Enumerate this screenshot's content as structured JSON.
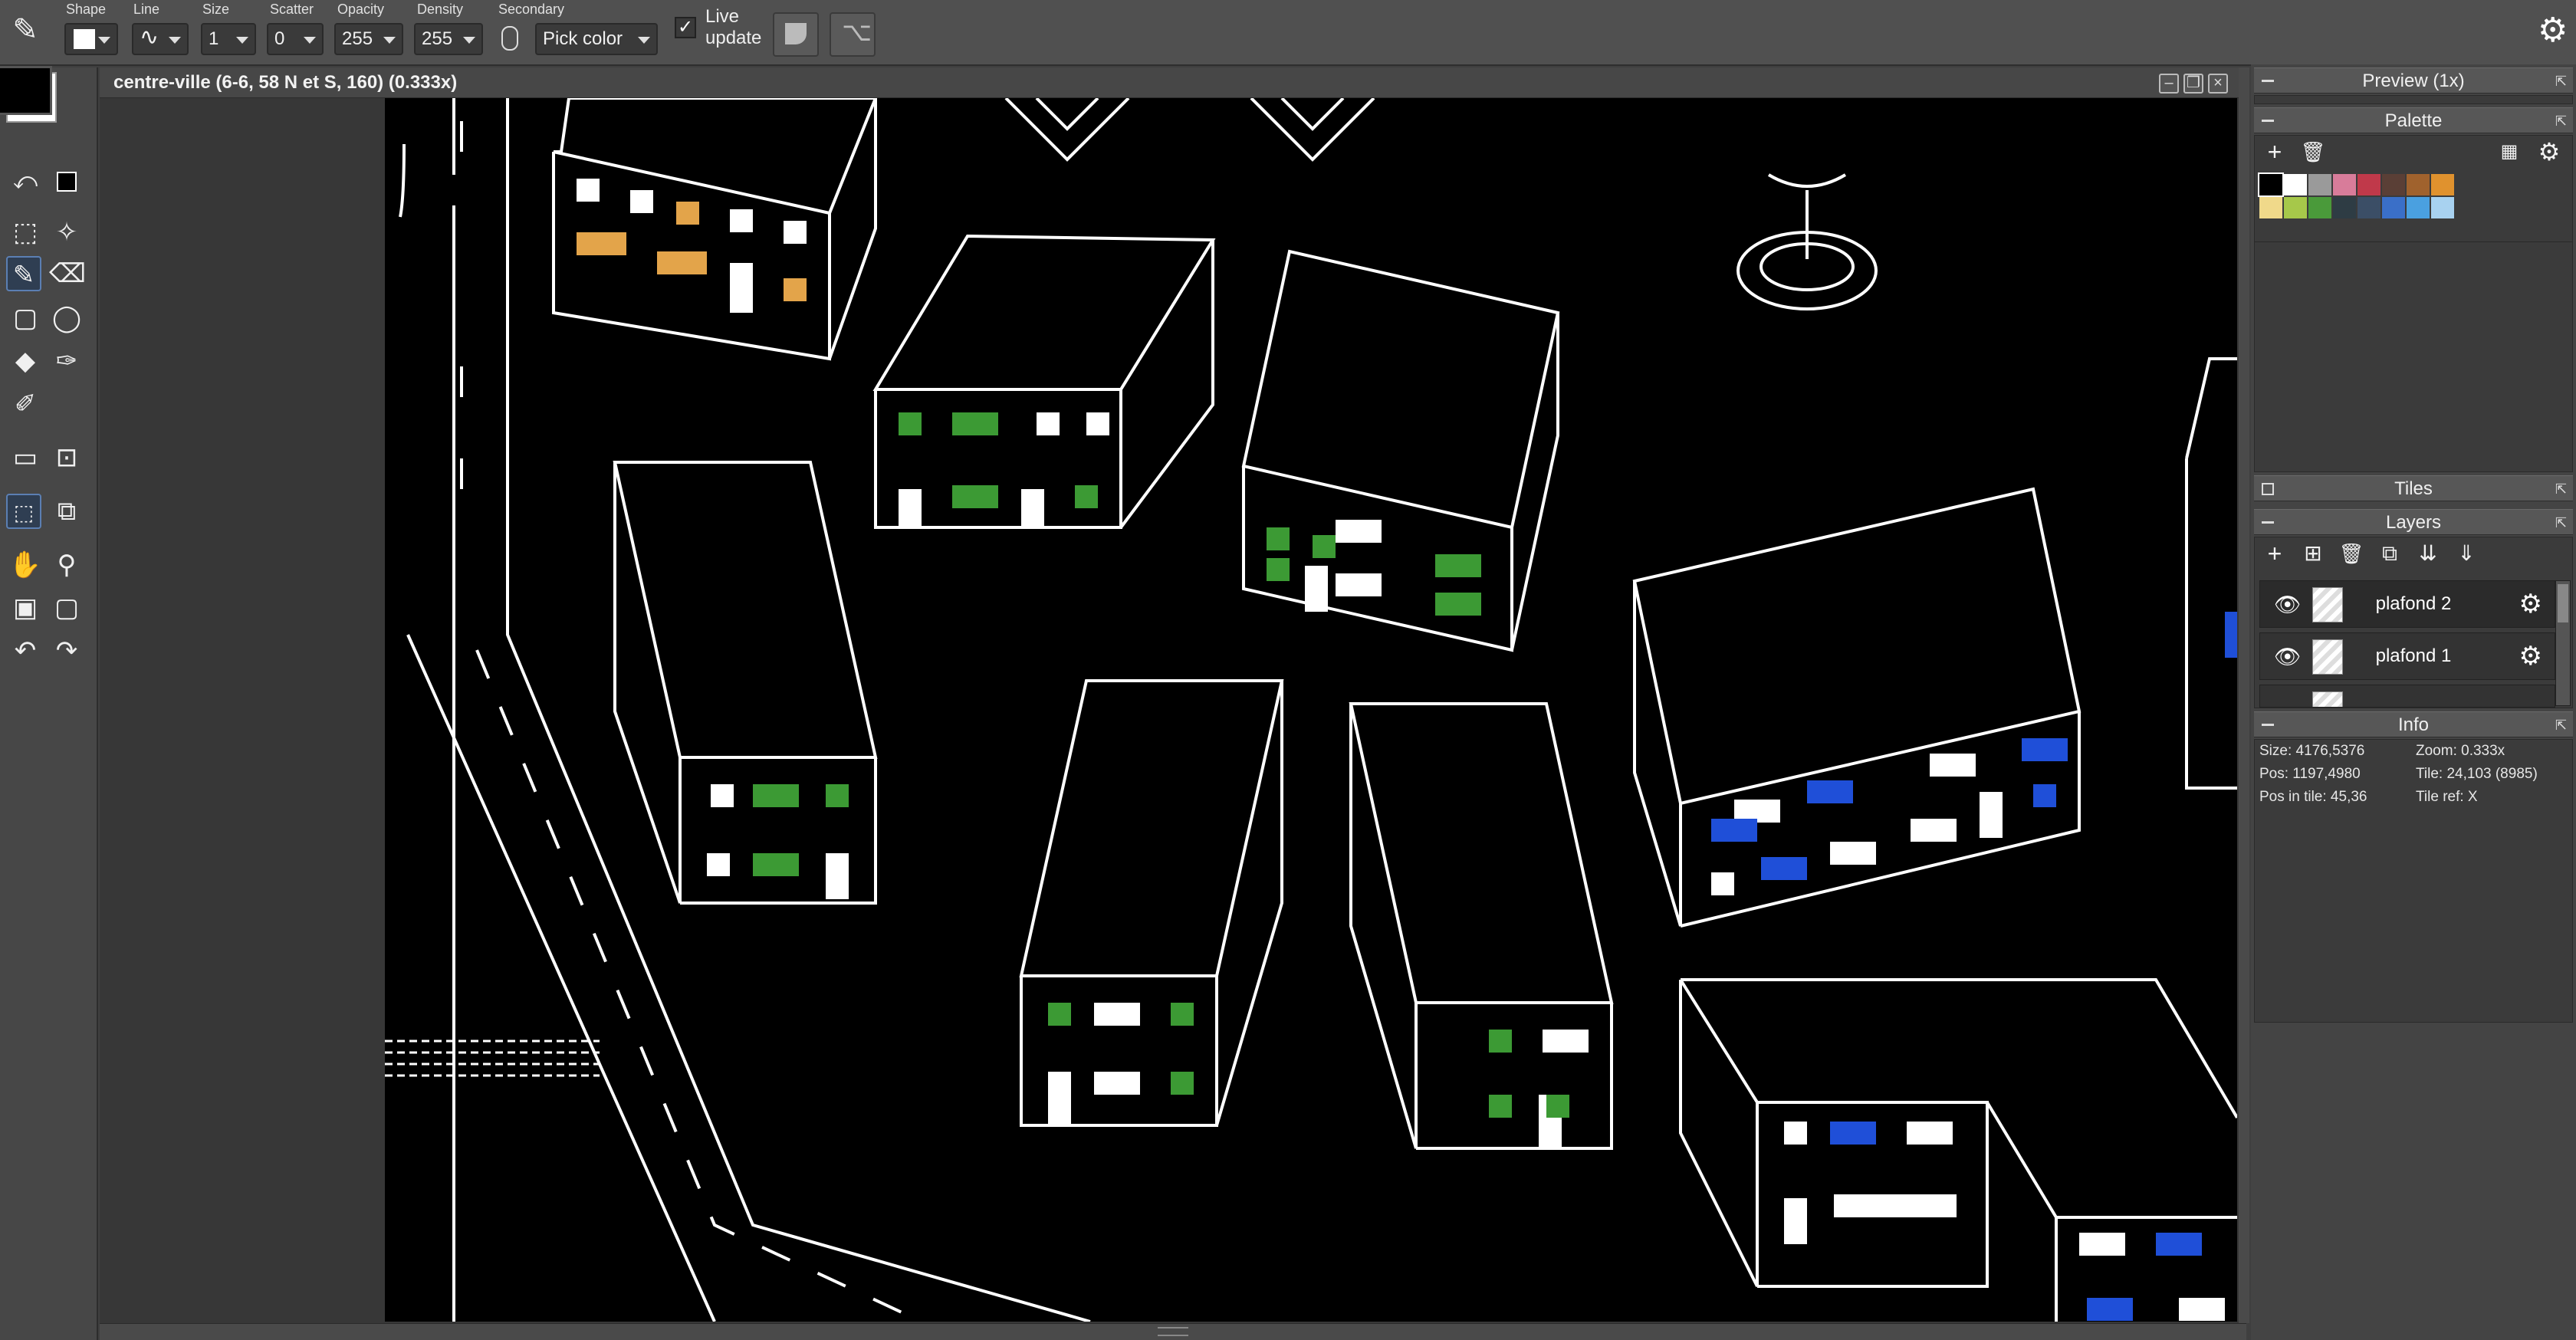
{
  "toolbar": {
    "shape_label": "Shape",
    "line_label": "Line",
    "size_label": "Size",
    "size_value": "1",
    "scatter_label": "Scatter",
    "scatter_value": "0",
    "opacity_label": "Opacity",
    "opacity_value": "255",
    "density_label": "Density",
    "density_value": "255",
    "secondary_label": "Secondary",
    "secondary_value": "Pick color",
    "live_update_label_1": "Live",
    "live_update_label_2": "update",
    "live_update_checked": true
  },
  "canvas": {
    "title": "centre-ville (6-6, 58 N et S, 160)  (0.333x)"
  },
  "dock": {
    "preview_title": "Preview (1x)",
    "palette_title": "Palette",
    "tiles_title": "Tiles",
    "layers_title": "Layers",
    "info_title": "Info",
    "palette_colors": [
      "#000000",
      "#ffffff",
      "#9a9a9a",
      "#d87c9a",
      "#c0394a",
      "#5a3f36",
      "#a0622d",
      "#e0922e",
      "#f0d98a",
      "#a6c84a",
      "#4a9a3a",
      "#2e3c44",
      "#3b4e66",
      "#3a6fc8",
      "#4aa0e0",
      "#a8d2f0"
    ],
    "layers": [
      {
        "name": "plafond 2"
      },
      {
        "name": "plafond 1"
      }
    ],
    "info": {
      "size": "Size: 4176,5376",
      "zoom": "Zoom: 0.333x",
      "pos": "Pos: 1197,4980",
      "tile": "Tile: 24,103 (8985)",
      "pos_in_tile": "Pos in tile: 45,36",
      "tile_ref": "Tile ref: X"
    }
  },
  "colors": {
    "fg": "#000000",
    "bg": "#ffffff",
    "window_green": "#3c9a34",
    "window_orange": "#e3a44a",
    "window_blue": "#1f4fd8"
  },
  "icons": [
    "pencil-icon",
    "gear-icon",
    "lasso-icon",
    "magic-wand-icon",
    "brush-icon",
    "eraser-icon",
    "rectangle-icon",
    "ellipse-icon",
    "fill-icon",
    "color-picker-icon",
    "hand-icon",
    "zoom-icon",
    "undo-icon",
    "redo-icon",
    "eye-icon",
    "plus-icon",
    "trash-icon"
  ]
}
